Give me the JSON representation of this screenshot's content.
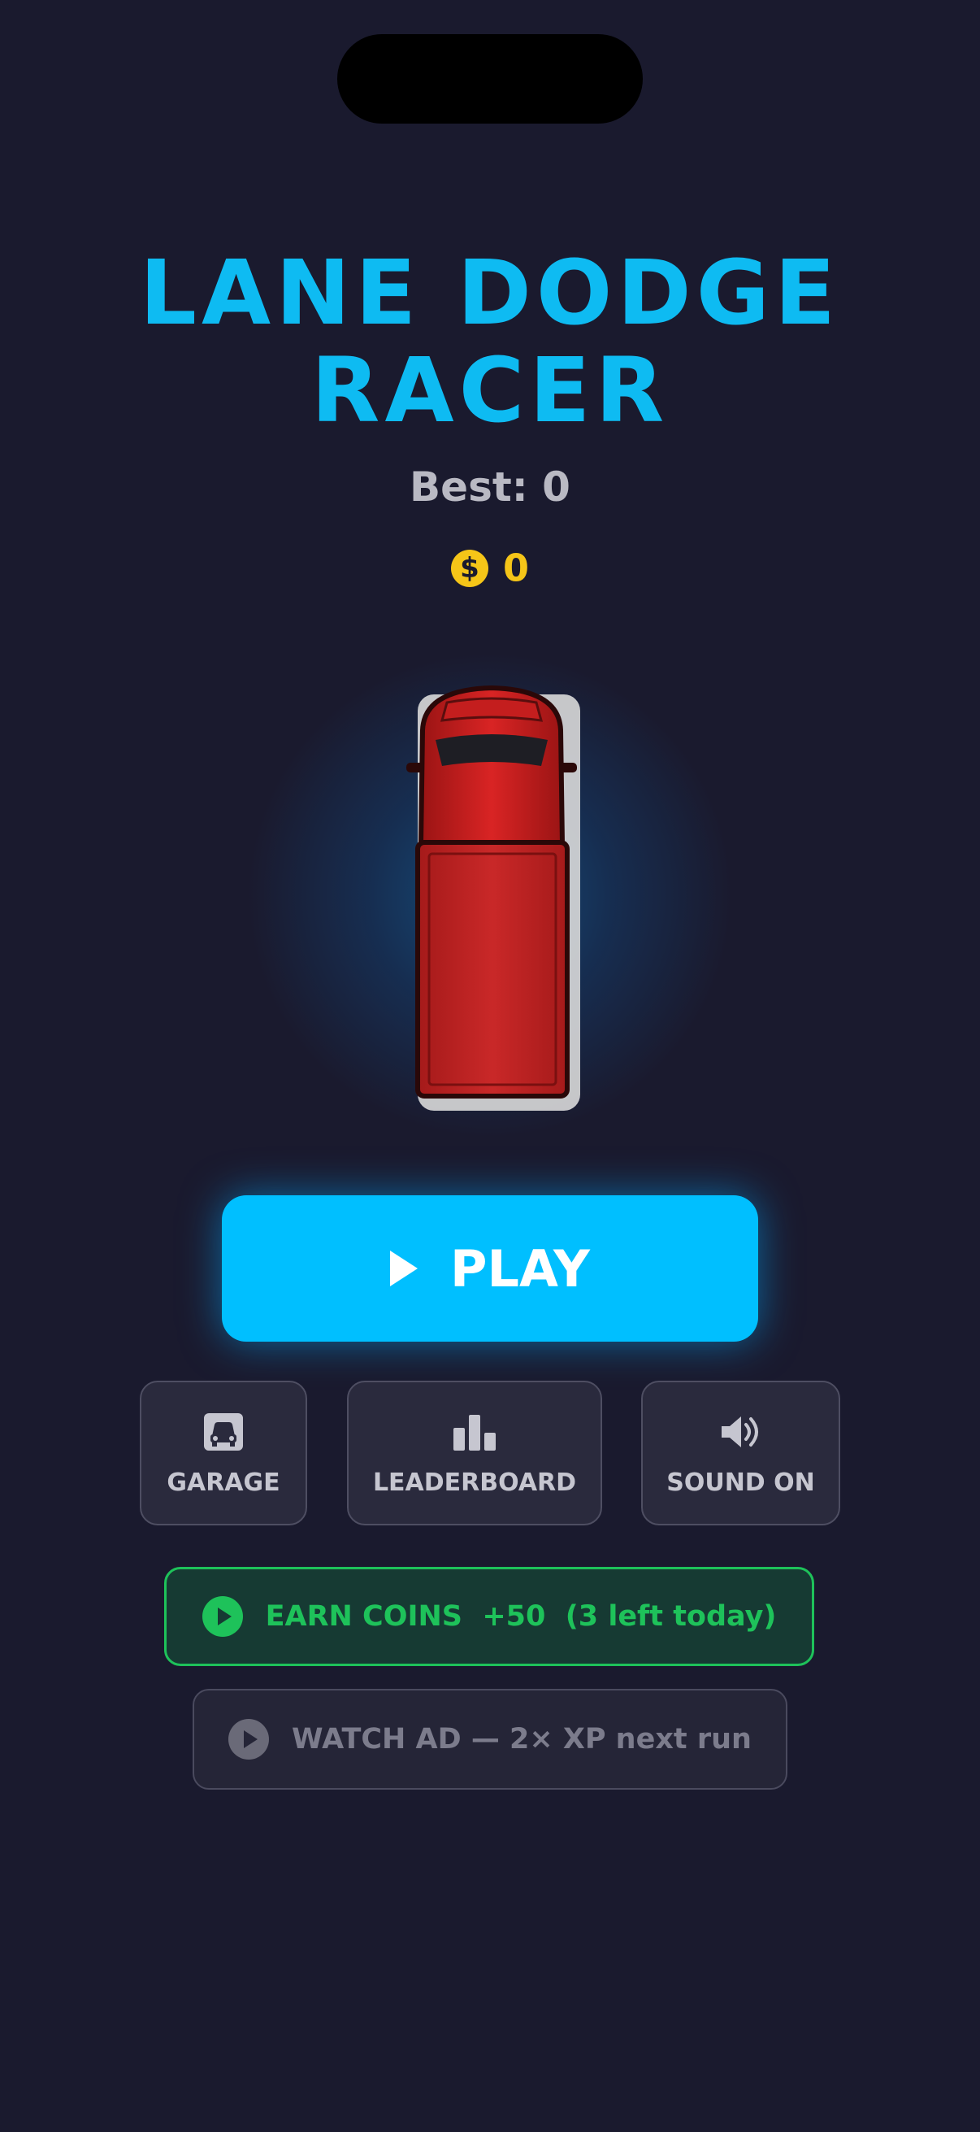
{
  "app": {
    "title_line1": "LANE DODGE",
    "title_line2": "RACER",
    "best_label": "Best: 0",
    "coins": "0"
  },
  "colors": {
    "background": "#1a1a2e",
    "title": "#0ebbf2",
    "play_button": "#00bfff",
    "coin": "#f5c518",
    "earn_green": "#1ec25a"
  },
  "icons": {
    "coin": "dollar-coin-icon",
    "play": "play-icon",
    "garage": "car-front-icon",
    "leaderboard": "bar-chart-icon",
    "sound": "speaker-icon",
    "earn": "play-circle-icon",
    "watch": "play-circle-icon"
  },
  "buttons": {
    "play": "PLAY",
    "garage": "GARAGE",
    "leaderboard": "LEADERBOARD",
    "sound": "SOUND ON",
    "earn_label": "EARN COINS",
    "earn_amount": "+50",
    "earn_remaining": "(3 left today)",
    "watch_ad": "WATCH AD — 2× XP next run"
  }
}
